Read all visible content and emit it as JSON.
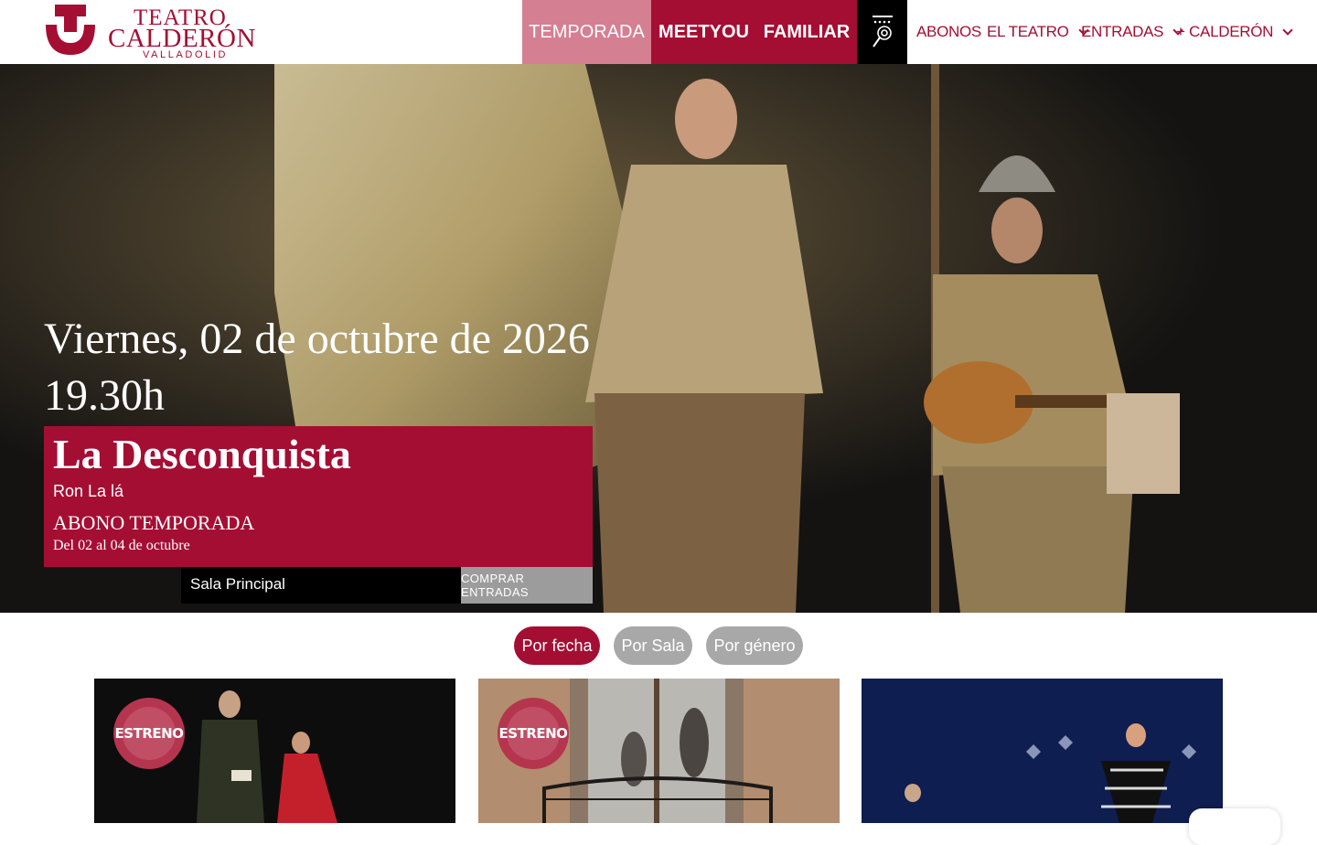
{
  "header": {
    "logo": {
      "line1": "TEATRO",
      "line2": "CALDERÓN",
      "line3": "VALLADOLID"
    },
    "tabs": [
      {
        "label": "TEMPORADA"
      },
      {
        "label": "MEETYOU"
      },
      {
        "label": "FAMILIAR"
      }
    ],
    "menu": {
      "abonos": "ABONOS",
      "el_teatro": "EL TEATRO",
      "entradas": "ENTRADAS",
      "mas_calderon": "+ CALDERÓN"
    }
  },
  "hero": {
    "date": "Viernes, 02 de octubre de 2026",
    "time": "19.30h",
    "title": "La Desconquista",
    "company": "Ron La lá",
    "cycle": "ABONO TEMPORADA",
    "dates": "Del 02 al 04 de octubre",
    "venue": "Sala Principal",
    "buy_label": "COMPRAR ENTRADAS"
  },
  "filters": [
    {
      "label": "Por fecha",
      "active": true
    },
    {
      "label": "Por Sala",
      "active": false
    },
    {
      "label": "Por género",
      "active": false
    }
  ],
  "cards": [
    {
      "badge": "ESTRENO"
    },
    {
      "badge": "ESTRENO"
    },
    {
      "badge": ""
    }
  ],
  "colors": {
    "brand": "#a50e33",
    "tab_active": "#d57f93",
    "filter_inactive": "#a8a8a8",
    "button_gray": "#9c9c9c"
  }
}
